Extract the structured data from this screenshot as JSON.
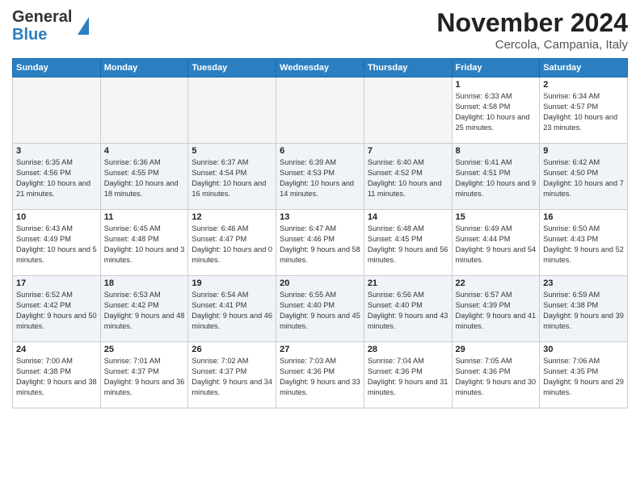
{
  "header": {
    "logo_general": "General",
    "logo_blue": "Blue",
    "month": "November 2024",
    "location": "Cercola, Campania, Italy"
  },
  "weekdays": [
    "Sunday",
    "Monday",
    "Tuesday",
    "Wednesday",
    "Thursday",
    "Friday",
    "Saturday"
  ],
  "days": [
    {
      "num": "",
      "sunrise": "",
      "sunset": "",
      "daylight": "",
      "empty": true
    },
    {
      "num": "",
      "sunrise": "",
      "sunset": "",
      "daylight": "",
      "empty": true
    },
    {
      "num": "",
      "sunrise": "",
      "sunset": "",
      "daylight": "",
      "empty": true
    },
    {
      "num": "",
      "sunrise": "",
      "sunset": "",
      "daylight": "",
      "empty": true
    },
    {
      "num": "",
      "sunrise": "",
      "sunset": "",
      "daylight": "",
      "empty": true
    },
    {
      "num": "1",
      "sunrise": "6:33 AM",
      "sunset": "4:58 PM",
      "daylight": "10 hours and 25 minutes."
    },
    {
      "num": "2",
      "sunrise": "6:34 AM",
      "sunset": "4:57 PM",
      "daylight": "10 hours and 23 minutes."
    },
    {
      "num": "3",
      "sunrise": "6:35 AM",
      "sunset": "4:56 PM",
      "daylight": "10 hours and 21 minutes."
    },
    {
      "num": "4",
      "sunrise": "6:36 AM",
      "sunset": "4:55 PM",
      "daylight": "10 hours and 18 minutes."
    },
    {
      "num": "5",
      "sunrise": "6:37 AM",
      "sunset": "4:54 PM",
      "daylight": "10 hours and 16 minutes."
    },
    {
      "num": "6",
      "sunrise": "6:39 AM",
      "sunset": "4:53 PM",
      "daylight": "10 hours and 14 minutes."
    },
    {
      "num": "7",
      "sunrise": "6:40 AM",
      "sunset": "4:52 PM",
      "daylight": "10 hours and 11 minutes."
    },
    {
      "num": "8",
      "sunrise": "6:41 AM",
      "sunset": "4:51 PM",
      "daylight": "10 hours and 9 minutes."
    },
    {
      "num": "9",
      "sunrise": "6:42 AM",
      "sunset": "4:50 PM",
      "daylight": "10 hours and 7 minutes."
    },
    {
      "num": "10",
      "sunrise": "6:43 AM",
      "sunset": "4:49 PM",
      "daylight": "10 hours and 5 minutes."
    },
    {
      "num": "11",
      "sunrise": "6:45 AM",
      "sunset": "4:48 PM",
      "daylight": "10 hours and 3 minutes."
    },
    {
      "num": "12",
      "sunrise": "6:46 AM",
      "sunset": "4:47 PM",
      "daylight": "10 hours and 0 minutes."
    },
    {
      "num": "13",
      "sunrise": "6:47 AM",
      "sunset": "4:46 PM",
      "daylight": "9 hours and 58 minutes."
    },
    {
      "num": "14",
      "sunrise": "6:48 AM",
      "sunset": "4:45 PM",
      "daylight": "9 hours and 56 minutes."
    },
    {
      "num": "15",
      "sunrise": "6:49 AM",
      "sunset": "4:44 PM",
      "daylight": "9 hours and 54 minutes."
    },
    {
      "num": "16",
      "sunrise": "6:50 AM",
      "sunset": "4:43 PM",
      "daylight": "9 hours and 52 minutes."
    },
    {
      "num": "17",
      "sunrise": "6:52 AM",
      "sunset": "4:42 PM",
      "daylight": "9 hours and 50 minutes."
    },
    {
      "num": "18",
      "sunrise": "6:53 AM",
      "sunset": "4:42 PM",
      "daylight": "9 hours and 48 minutes."
    },
    {
      "num": "19",
      "sunrise": "6:54 AM",
      "sunset": "4:41 PM",
      "daylight": "9 hours and 46 minutes."
    },
    {
      "num": "20",
      "sunrise": "6:55 AM",
      "sunset": "4:40 PM",
      "daylight": "9 hours and 45 minutes."
    },
    {
      "num": "21",
      "sunrise": "6:56 AM",
      "sunset": "4:40 PM",
      "daylight": "9 hours and 43 minutes."
    },
    {
      "num": "22",
      "sunrise": "6:57 AM",
      "sunset": "4:39 PM",
      "daylight": "9 hours and 41 minutes."
    },
    {
      "num": "23",
      "sunrise": "6:59 AM",
      "sunset": "4:38 PM",
      "daylight": "9 hours and 39 minutes."
    },
    {
      "num": "24",
      "sunrise": "7:00 AM",
      "sunset": "4:38 PM",
      "daylight": "9 hours and 38 minutes."
    },
    {
      "num": "25",
      "sunrise": "7:01 AM",
      "sunset": "4:37 PM",
      "daylight": "9 hours and 36 minutes."
    },
    {
      "num": "26",
      "sunrise": "7:02 AM",
      "sunset": "4:37 PM",
      "daylight": "9 hours and 34 minutes."
    },
    {
      "num": "27",
      "sunrise": "7:03 AM",
      "sunset": "4:36 PM",
      "daylight": "9 hours and 33 minutes."
    },
    {
      "num": "28",
      "sunrise": "7:04 AM",
      "sunset": "4:36 PM",
      "daylight": "9 hours and 31 minutes."
    },
    {
      "num": "29",
      "sunrise": "7:05 AM",
      "sunset": "4:36 PM",
      "daylight": "9 hours and 30 minutes."
    },
    {
      "num": "30",
      "sunrise": "7:06 AM",
      "sunset": "4:35 PM",
      "daylight": "9 hours and 29 minutes."
    }
  ]
}
